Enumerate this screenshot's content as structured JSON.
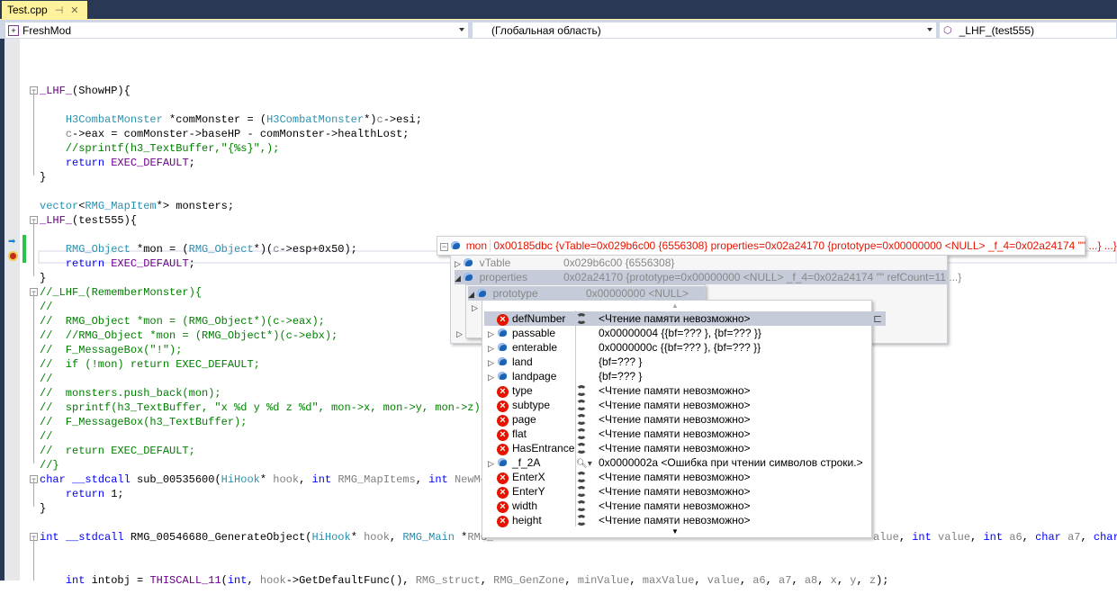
{
  "tab": {
    "label": "Test.cpp",
    "pin_icon": "pin-icon",
    "close_icon": "close-icon"
  },
  "nav": {
    "project": "FreshMod",
    "scope": "(Глобальная область)",
    "member": "_LHF_(test555)"
  },
  "colors": {
    "keyword": "#0000ff",
    "type": "#2b91af",
    "macro": "#6f008a",
    "comment": "#008000",
    "param": "#808080",
    "tab": "#fff29d",
    "frame": "#293955",
    "error": "#e51400"
  },
  "code": [
    {
      "line": 0,
      "fold": true,
      "seg": [
        [
          "m",
          "_LHF_"
        ],
        [
          "n",
          "(ShowHP){"
        ]
      ]
    },
    {
      "line": 2,
      "seg": [
        [
          "n",
          "    "
        ],
        [
          "t",
          "H3CombatMonster"
        ],
        [
          "n",
          " *comMonster = ("
        ],
        [
          "t",
          "H3CombatMonster"
        ],
        [
          "n",
          "*)"
        ],
        [
          "p",
          "c"
        ],
        [
          "n",
          "->esi;"
        ]
      ]
    },
    {
      "line": 3,
      "seg": [
        [
          "n",
          "    "
        ],
        [
          "p",
          "c"
        ],
        [
          "n",
          "->eax = comMonster->baseHP - comMonster->healthLost;"
        ]
      ]
    },
    {
      "line": 4,
      "seg": [
        [
          "c",
          "    //sprintf(h3_TextBuffer,\"{%s}\",);"
        ]
      ]
    },
    {
      "line": 5,
      "seg": [
        [
          "n",
          "    "
        ],
        [
          "k",
          "return"
        ],
        [
          "n",
          " "
        ],
        [
          "m",
          "EXEC_DEFAULT"
        ],
        [
          "n",
          ";"
        ]
      ]
    },
    {
      "line": 6,
      "seg": [
        [
          "n",
          "}"
        ]
      ]
    },
    {
      "line": 8,
      "seg": [
        [
          "t",
          "vector"
        ],
        [
          "n",
          "<"
        ],
        [
          "t",
          "RMG_MapItem"
        ],
        [
          "n",
          "*> monsters;"
        ]
      ]
    },
    {
      "line": 9,
      "fold": true,
      "seg": [
        [
          "m",
          "_LHF_"
        ],
        [
          "n",
          "(test555){"
        ]
      ]
    },
    {
      "line": 11,
      "seg": [
        [
          "n",
          "    "
        ],
        [
          "t",
          "RMG_Object"
        ],
        [
          "n",
          " *mon = ("
        ],
        [
          "t",
          "RMG_Object"
        ],
        [
          "n",
          "*)("
        ],
        [
          "p",
          "c"
        ],
        [
          "n",
          "->esp+0x50);"
        ]
      ]
    },
    {
      "line": 12,
      "seg": [
        [
          "n",
          "    "
        ],
        [
          "k",
          "return"
        ],
        [
          "n",
          " "
        ],
        [
          "m",
          "EXEC_DEFAULT"
        ],
        [
          "n",
          ";"
        ]
      ]
    },
    {
      "line": 13,
      "seg": [
        [
          "n",
          "}"
        ]
      ]
    },
    {
      "line": 14,
      "fold": true,
      "seg": [
        [
          "c",
          "//_LHF_(RememberMonster){"
        ]
      ]
    },
    {
      "line": 15,
      "seg": [
        [
          "c",
          "//"
        ]
      ]
    },
    {
      "line": 16,
      "seg": [
        [
          "c",
          "//  RMG_Object *mon = (RMG_Object*)(c->eax);"
        ]
      ]
    },
    {
      "line": 17,
      "seg": [
        [
          "c",
          "//  //RMG_Object *mon = (RMG_Object*)(c->ebx);"
        ]
      ]
    },
    {
      "line": 18,
      "seg": [
        [
          "c",
          "//  F_MessageBox(\"!\");"
        ]
      ]
    },
    {
      "line": 19,
      "seg": [
        [
          "c",
          "//  if (!mon) return EXEC_DEFAULT;"
        ]
      ]
    },
    {
      "line": 20,
      "seg": [
        [
          "c",
          "//"
        ]
      ]
    },
    {
      "line": 21,
      "seg": [
        [
          "c",
          "//  monsters.push_back(mon);"
        ]
      ]
    },
    {
      "line": 22,
      "seg": [
        [
          "c",
          "//  sprintf(h3_TextBuffer, \"x %d y %d z %d\", mon->x, mon->y, mon->z);"
        ]
      ]
    },
    {
      "line": 23,
      "seg": [
        [
          "c",
          "//  F_MessageBox(h3_TextBuffer);"
        ]
      ]
    },
    {
      "line": 24,
      "seg": [
        [
          "c",
          "//"
        ]
      ]
    },
    {
      "line": 25,
      "seg": [
        [
          "c",
          "//  return EXEC_DEFAULT;"
        ]
      ]
    },
    {
      "line": 26,
      "seg": [
        [
          "c",
          "//}"
        ]
      ]
    },
    {
      "line": 27,
      "fold": true,
      "seg": [
        [
          "k",
          "char"
        ],
        [
          "n",
          " "
        ],
        [
          "k",
          "__stdcall"
        ],
        [
          "n",
          " sub_00535600("
        ],
        [
          "t",
          "HiHook"
        ],
        [
          "n",
          "* "
        ],
        [
          "p",
          "hook"
        ],
        [
          "n",
          ", "
        ],
        [
          "k",
          "int"
        ],
        [
          "n",
          " "
        ],
        [
          "p",
          "RMG_MapItems"
        ],
        [
          "n",
          ", "
        ],
        [
          "k",
          "int"
        ],
        [
          "n",
          " "
        ],
        [
          "p",
          "NewMon"
        ]
      ]
    },
    {
      "line": 28,
      "seg": [
        [
          "n",
          "    "
        ],
        [
          "k",
          "return"
        ],
        [
          "n",
          " 1;"
        ]
      ]
    },
    {
      "line": 29,
      "seg": [
        [
          "n",
          "}"
        ]
      ]
    },
    {
      "line": 31,
      "fold": true,
      "seg": [
        [
          "k",
          "int"
        ],
        [
          "n",
          " "
        ],
        [
          "k",
          "__stdcall"
        ],
        [
          "n",
          " RMG_00546680_GenerateObject("
        ],
        [
          "t",
          "HiHook"
        ],
        [
          "n",
          "* "
        ],
        [
          "p",
          "hook"
        ],
        [
          "n",
          ", "
        ],
        [
          "t",
          "RMG_Main"
        ],
        [
          "n",
          " *"
        ],
        [
          "p",
          "RMG_"
        ]
      ]
    },
    {
      "line": 34,
      "seg": [
        [
          "n",
          "    "
        ],
        [
          "k",
          "int"
        ],
        [
          "n",
          " intobj = "
        ],
        [
          "m",
          "THISCALL_11"
        ],
        [
          "n",
          "("
        ],
        [
          "k",
          "int"
        ],
        [
          "n",
          ", "
        ],
        [
          "p",
          "hook"
        ],
        [
          "n",
          "->GetDefaultFunc(), "
        ],
        [
          "p",
          "RMG_struct"
        ],
        [
          "n",
          ", "
        ],
        [
          "p",
          "RMG_GenZone"
        ],
        [
          "n",
          ", "
        ],
        [
          "p",
          "minValue"
        ],
        [
          "n",
          ", "
        ],
        [
          "p",
          "maxValue"
        ],
        [
          "n",
          ", "
        ],
        [
          "p",
          "value"
        ],
        [
          "n",
          ", "
        ],
        [
          "p",
          "a6"
        ],
        [
          "n",
          ", "
        ],
        [
          "p",
          "a7"
        ],
        [
          "n",
          ", "
        ],
        [
          "p",
          "a8"
        ],
        [
          "n",
          ", "
        ],
        [
          "p",
          "x"
        ],
        [
          "n",
          ", "
        ],
        [
          "p",
          "y"
        ],
        [
          "n",
          ", "
        ],
        [
          "p",
          "z"
        ],
        [
          "n",
          ");"
        ]
      ]
    }
  ],
  "code_tail": [
    [
      "p",
      "alue"
    ],
    [
      "n",
      ", "
    ],
    [
      "k",
      "int"
    ],
    [
      "n",
      " "
    ],
    [
      "p",
      "value"
    ],
    [
      "n",
      ", "
    ],
    [
      "k",
      "int"
    ],
    [
      "n",
      " "
    ],
    [
      "p",
      "a6"
    ],
    [
      "n",
      ", "
    ],
    [
      "k",
      "char"
    ],
    [
      "n",
      " "
    ],
    [
      "p",
      "a7"
    ],
    [
      "n",
      ", "
    ],
    [
      "k",
      "char"
    ]
  ],
  "datatip": {
    "name": "mon",
    "value": "0x00185dbc {vTable=0x029b6c00 {6556308} properties=0x02a24170 {prototype=0x00000000 <NULL> _f_4=0x02a24174 \"\" ...} ...}",
    "children": [
      {
        "name": "vTable",
        "value": "0x029b6c00 {6556308}"
      },
      {
        "name": "properties",
        "value": "0x02a24170 {prototype=0x00000000 <NULL> _f_4=0x02a24174 \"\" refCount=11 ...}"
      }
    ],
    "prototype": {
      "name": "prototype",
      "value": "0x00000000 <NULL>"
    },
    "members": [
      {
        "name": "defNumber",
        "icon": "error",
        "value": "<Чтение памяти невозможно>"
      },
      {
        "name": "passable",
        "icon": "field",
        "value": "0x00000004 {{bf=??? }, {bf=??? }}"
      },
      {
        "name": "enterable",
        "icon": "field",
        "value": "0x0000000c {{bf=??? }, {bf=??? }}"
      },
      {
        "name": "land",
        "icon": "field",
        "value": "{bf=??? }"
      },
      {
        "name": "landpage",
        "icon": "field",
        "value": "{bf=??? }"
      },
      {
        "name": "type",
        "icon": "error",
        "value": "<Чтение памяти невозможно>"
      },
      {
        "name": "subtype",
        "icon": "error",
        "value": "<Чтение памяти невозможно>"
      },
      {
        "name": "page",
        "icon": "error",
        "value": "<Чтение памяти невозможно>"
      },
      {
        "name": "flat",
        "icon": "error",
        "value": "<Чтение памяти невозможно>"
      },
      {
        "name": "HasEntrance",
        "icon": "error",
        "value": "<Чтение памяти невозможно>"
      },
      {
        "name": "_f_2A",
        "icon": "field",
        "value": "0x0000002a <Ошибка при чтении символов строки.>"
      },
      {
        "name": "EnterX",
        "icon": "error",
        "value": "<Чтение памяти невозможно>"
      },
      {
        "name": "EnterY",
        "icon": "error",
        "value": "<Чтение памяти невозможно>"
      },
      {
        "name": "width",
        "icon": "error",
        "value": "<Чтение памяти невозможно>"
      },
      {
        "name": "height",
        "icon": "error",
        "value": "<Чтение памяти невозможно>"
      }
    ]
  }
}
